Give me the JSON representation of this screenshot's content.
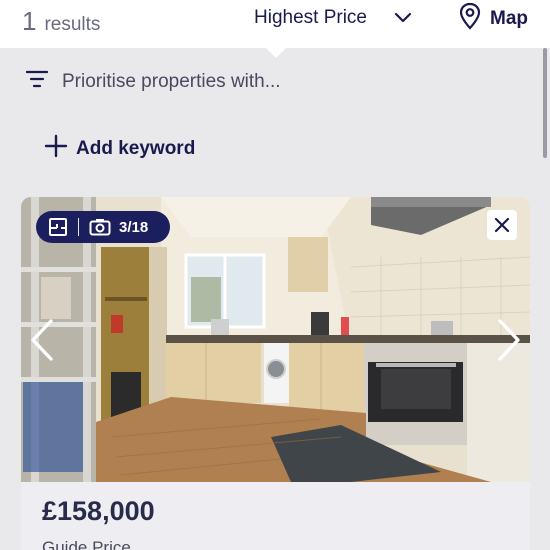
{
  "header": {
    "results_count": "1",
    "results_label": "results",
    "sort_label": "Highest Price",
    "map_label": "Map"
  },
  "filter": {
    "prioritise_label": "Prioritise properties with...",
    "add_keyword_label": "Add keyword"
  },
  "listing": {
    "photo_counter": "3/18",
    "price": "£158,000",
    "price_qualifier": "Guide Price"
  },
  "icons": {
    "sort": "chevron-down-icon",
    "map": "map-pin-icon",
    "filter": "filter-lines-icon",
    "add": "plus-icon",
    "floorplan": "floorplan-icon",
    "camera": "camera-icon",
    "close": "close-icon",
    "prev": "chevron-left-icon",
    "next": "chevron-right-icon"
  },
  "colors": {
    "brand_navy": "#1b1f5e",
    "text_primary": "#1a1a4e",
    "background": "#e9e9ec"
  }
}
